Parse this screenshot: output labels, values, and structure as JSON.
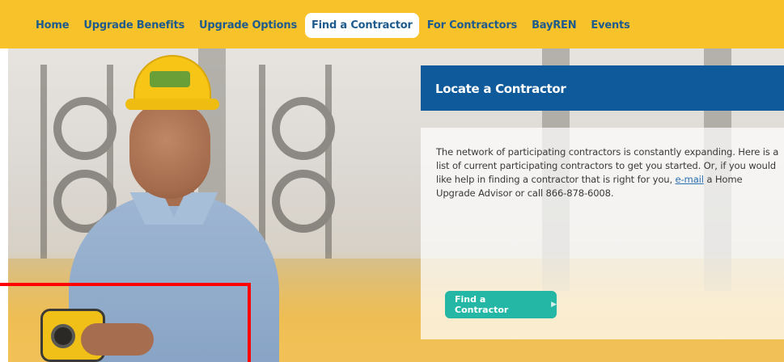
{
  "nav": {
    "items": [
      {
        "label": "Home"
      },
      {
        "label": "Upgrade Benefits"
      },
      {
        "label": "Upgrade Options"
      },
      {
        "label": "Find a Contractor",
        "active": true
      },
      {
        "label": "For Contractors"
      },
      {
        "label": "BayREN"
      },
      {
        "label": "Events"
      }
    ]
  },
  "card": {
    "title": "Locate a Contractor",
    "text_before_link": "The network of participating contractors is constantly expanding. Here is a list of current participating contractors to get you started. Or, if you would like help in finding a contractor that is right for you, ",
    "link_text": "e-mail",
    "text_after_link": " a Home Upgrade Advisor or call 866-878-6008.",
    "button_label": "Find a Contractor",
    "button_icon": "chevron-right-icon"
  },
  "colors": {
    "nav_bar": "#f7c22a",
    "nav_text": "#1d5b8e",
    "title_bar": "#0f5a9a",
    "button": "#25b7a6",
    "highlight": "#ff0000"
  }
}
